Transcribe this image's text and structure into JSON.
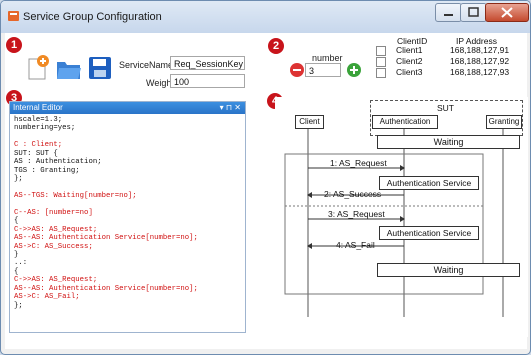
{
  "window": {
    "title": "Service Group Configuration"
  },
  "toolbar": {
    "service_name_label": "ServiceName",
    "service_name_value": "Req_SessionKey",
    "weight_label": "Weight",
    "weight_value": "100"
  },
  "number_panel": {
    "label": "number",
    "value": "3"
  },
  "clients": {
    "headers": [
      "ClientID",
      "IP Address"
    ],
    "rows": [
      {
        "id": "Client1",
        "ip": "168,188,127,91"
      },
      {
        "id": "Client2",
        "ip": "168,188,127,92"
      },
      {
        "id": "Client3",
        "ip": "168,188,127,93"
      }
    ]
  },
  "editor": {
    "title": "Internal Editor",
    "pin": "▾ ⊓ ✕",
    "lines": [
      "hscale=1.3;",
      "numbering=yes;",
      "",
      "C : Client;",
      "SUT: SUT {",
      "AS : Authentication;",
      "TGS : Granting;",
      "};",
      "",
      "AS--TGS: Waiting[number=no];",
      "",
      "C--AS: [number=no]",
      "{",
      "C->>AS: AS_Request;",
      "AS--AS: Authentication Service[number=no];",
      "AS->C: AS_Success;",
      "}",
      "..:",
      "{",
      "C->>AS: AS_Request;",
      "AS--AS: Authentication Service[number=no];",
      "AS->C: AS_Fail;",
      "};"
    ]
  },
  "diagram": {
    "sut": "SUT",
    "client": "Client",
    "auth": "Authentication",
    "granting": "Granting",
    "waiting1": "Waiting",
    "m1": "1: AS_Request",
    "svc1": "Authentication Service",
    "m2": "2: AS_Success",
    "m3": "3: AS_Request",
    "svc2": "Authentication Service",
    "m4": "4: AS_Fail",
    "waiting2": "Waiting"
  },
  "badges": {
    "b1": "1",
    "b2": "2",
    "b3": "3",
    "b4": "4"
  }
}
